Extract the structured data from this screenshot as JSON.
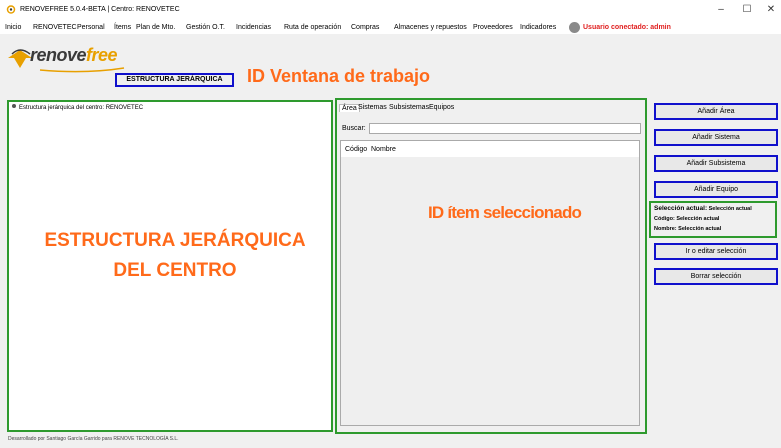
{
  "window": {
    "title": "RENOVEFREE 5.0.4-BETA | Centro: RENOVETEC",
    "controls": {
      "minimize": "–",
      "maximize": "☐",
      "close": "✕"
    }
  },
  "menu": {
    "items": [
      "Inicio",
      "RENOVETEC",
      "Personal",
      "Ítems",
      "Plan de Mto.",
      "Gestión O.T.",
      "Incidencias",
      "Ruta de operación",
      "Compras",
      "Almacenes y repuestos",
      "Proveedores",
      "Indicadores"
    ],
    "user": "Usuario conectado: admin"
  },
  "logo": {
    "main": "renove",
    "accent": "free"
  },
  "workspace": {
    "label": "ESTRUCTURA JERÁRQUICA",
    "annotation": "ID Ventana de trabajo"
  },
  "tree": {
    "root": "Estructura jerárquica del centro: RENOVETEC",
    "annotation_line1": "ESTRUCTURA JERÁRQUICA",
    "annotation_line2": "DEL CENTRO"
  },
  "tabs": [
    "Área",
    "Sistemas",
    "Subsistemas",
    "Equipos"
  ],
  "search": {
    "label": "Buscar:",
    "value": ""
  },
  "table": {
    "columns": [
      "Código",
      "Nombre"
    ]
  },
  "annotation_item": "ID ítem seleccionado",
  "buttons": {
    "add_area": "Añadir Área",
    "add_system": "Añadir Sistema",
    "add_subsystem": "Añadir Subsistema",
    "add_equipment": "Añadir Equipo",
    "edit_selection": "Ir o editar selección",
    "delete_selection": "Borrar selección"
  },
  "selection": {
    "current_label": "Selección actual:",
    "current_value": "Selección actual",
    "code_label": "Código:",
    "code_value": "Selección actual",
    "name_label": "Nombre:",
    "name_value": "Selección actual"
  },
  "footer": "Desarrollado por Santiago García Garrido para RENOVE TECNOLOGÍA S.L.",
  "colors": {
    "annotation": "#ff6a1a",
    "green_frame": "#2e9a2e",
    "blue_frame": "#1010cc",
    "user": "#e02020"
  }
}
